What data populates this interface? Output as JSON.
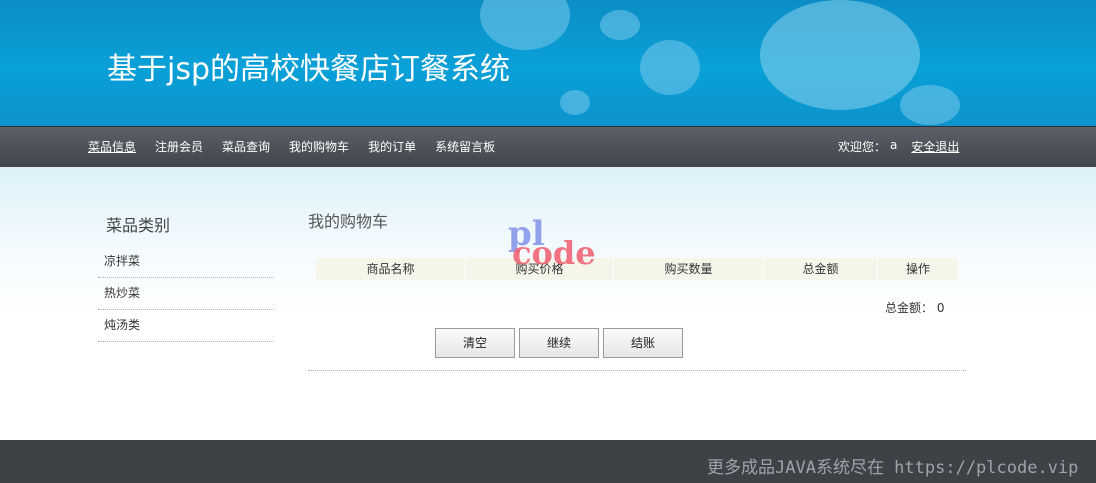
{
  "header": {
    "site_title": "基于jsp的高校快餐店订餐系统"
  },
  "nav": {
    "items": [
      {
        "label": "菜品信息",
        "active": true
      },
      {
        "label": "注册会员",
        "active": false
      },
      {
        "label": "菜品查询",
        "active": false
      },
      {
        "label": "我的购物车",
        "active": false
      },
      {
        "label": "我的订单",
        "active": false
      },
      {
        "label": "系统留言板",
        "active": false
      }
    ],
    "welcome_label": "欢迎您：",
    "username": "a",
    "logout_label": "安全退出"
  },
  "sidebar": {
    "title": "菜品类别",
    "items": [
      {
        "label": "凉拌菜"
      },
      {
        "label": "热炒菜"
      },
      {
        "label": "炖汤类"
      }
    ]
  },
  "main": {
    "title": "我的购物车",
    "table": {
      "columns": [
        "商品名称",
        "购买价格",
        "购买数量",
        "总金额",
        "操作"
      ],
      "rows": []
    },
    "total_label": "总金额：",
    "total_value": "0",
    "buttons": {
      "clear": "清空",
      "continue": "继续",
      "checkout": "结账"
    }
  },
  "watermark": {
    "logo_top": "pl",
    "logo_bottom": "code",
    "footer_text": "更多成品JAVA系统尽在 https://plcode.vip"
  },
  "colors": {
    "banner": "#0aa0d8",
    "navbar": "#4a4f55",
    "footer": "#3d4247",
    "table_header": "#f5f5ea"
  }
}
